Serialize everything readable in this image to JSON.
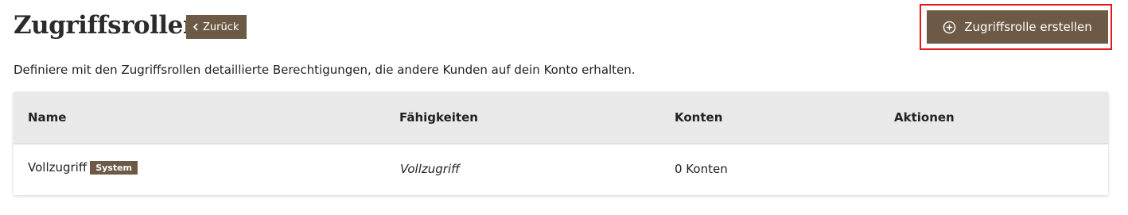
{
  "header": {
    "title": "Zugriffsrollen",
    "back_label": "Zurück",
    "create_label": "Zugriffsrolle erstellen"
  },
  "description": "Definiere mit den Zugriffsrollen detaillierte Berechtigungen, die andere Kunden auf dein Konto erhalten.",
  "table": {
    "columns": [
      "Name",
      "Fähigkeiten",
      "Konten",
      "Aktionen"
    ],
    "rows": [
      {
        "name": "Vollzugriff",
        "badge": "System",
        "capabilities": "Vollzugriff",
        "accounts": "0 Konten",
        "actions": ""
      }
    ]
  },
  "colors": {
    "accent": "#6d5a46",
    "highlight_border": "#e01b1b",
    "header_bg": "#e9e9e9"
  },
  "icons": {
    "back": "chevron-left-icon",
    "create": "plus-circle-icon"
  }
}
